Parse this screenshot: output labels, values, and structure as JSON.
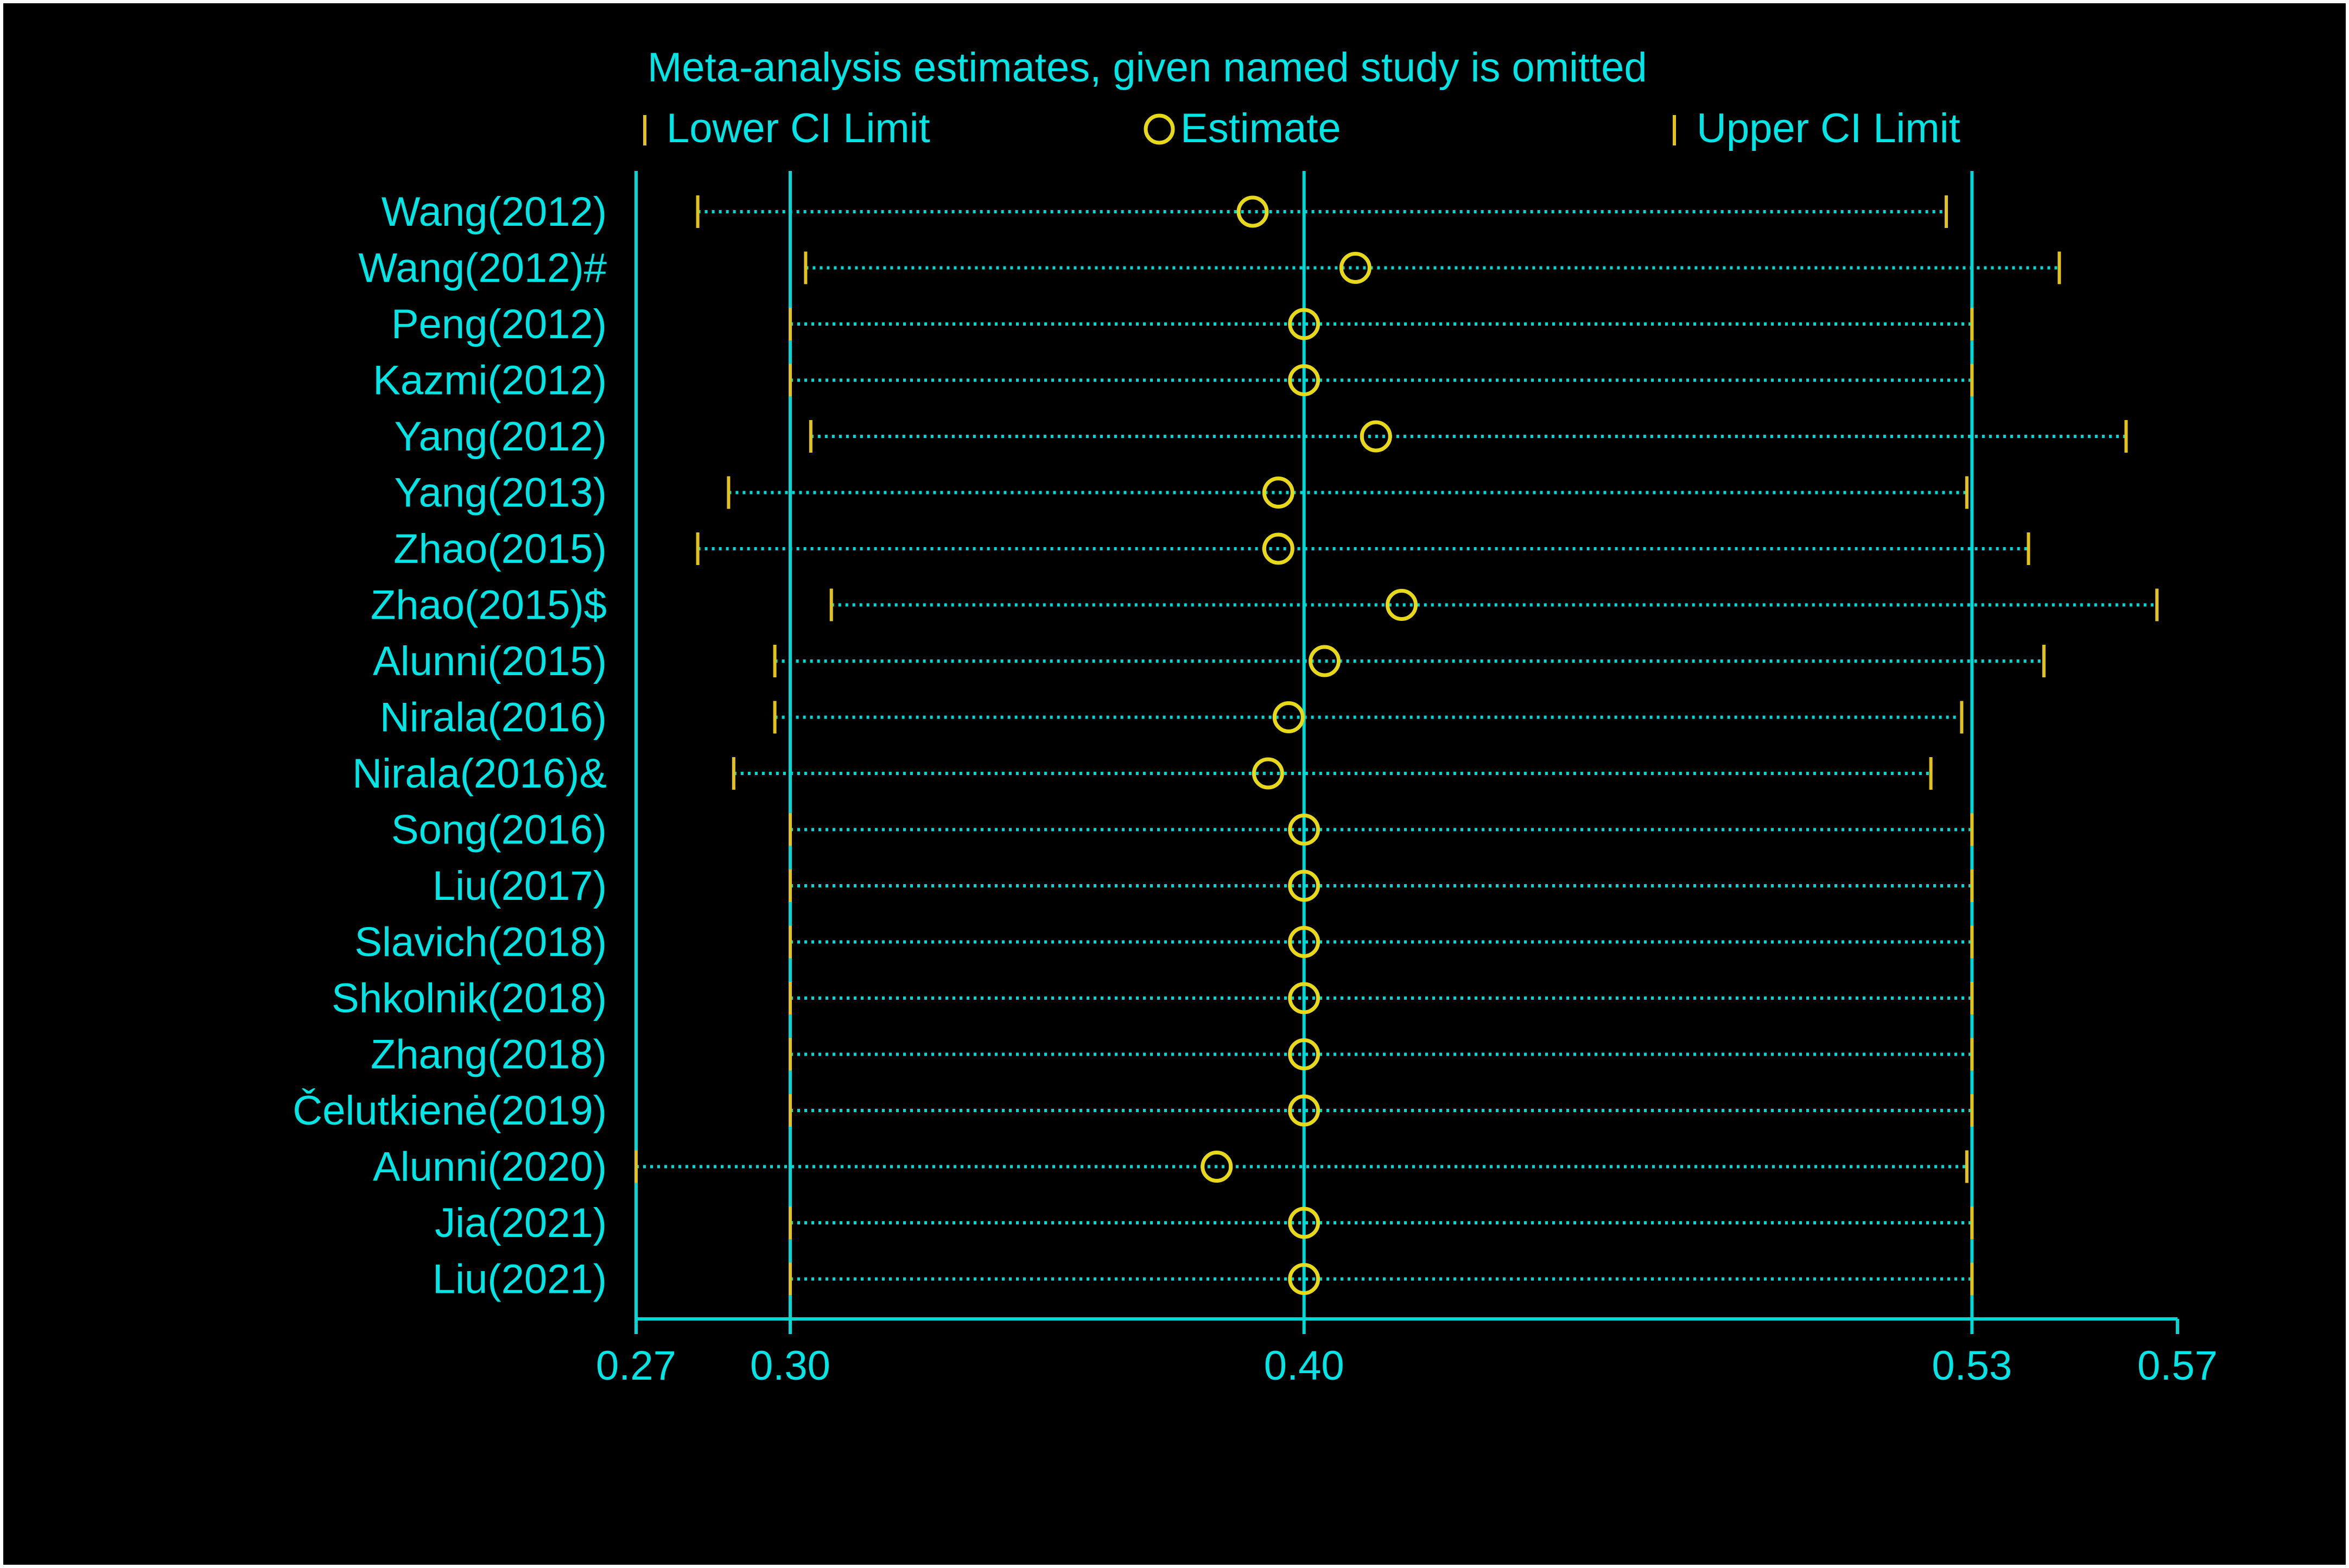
{
  "colors": {
    "background": "#000000",
    "frame": "#ffffff",
    "text": "#00e5e5",
    "axis": "#00d8d8",
    "ci_marker": "#e3c21a",
    "estimate": "#e8d81a",
    "dotted_line": "#00d8d8"
  },
  "chart_data": {
    "type": "scatter",
    "title": "Meta-analysis estimates, given named study is omitted",
    "legend": [
      {
        "symbol": "tick",
        "label": "Lower CI Limit"
      },
      {
        "symbol": "circle",
        "label": "Estimate"
      },
      {
        "symbol": "tick",
        "label": "Upper CI Limit"
      }
    ],
    "legend_position": "top",
    "x_ticks": [
      {
        "value": 0.27,
        "label": "0.27"
      },
      {
        "value": 0.3,
        "label": "0.30"
      },
      {
        "value": 0.4,
        "label": "0.40"
      },
      {
        "value": 0.53,
        "label": "0.53"
      },
      {
        "value": 0.57,
        "label": "0.57"
      }
    ],
    "x_range": [
      0.27,
      0.57
    ],
    "reference_lines": [
      0.27,
      0.3,
      0.4,
      0.53
    ],
    "studies": [
      {
        "name": "Wang(2012)",
        "lower": 0.282,
        "estimate": 0.39,
        "upper": 0.525
      },
      {
        "name": "Wang(2012)#",
        "lower": 0.303,
        "estimate": 0.41,
        "upper": 0.547
      },
      {
        "name": "Peng(2012)",
        "lower": 0.3,
        "estimate": 0.4,
        "upper": 0.53
      },
      {
        "name": "Kazmi(2012)",
        "lower": 0.3,
        "estimate": 0.4,
        "upper": 0.53
      },
      {
        "name": "Yang(2012)",
        "lower": 0.304,
        "estimate": 0.414,
        "upper": 0.56
      },
      {
        "name": "Yang(2013)",
        "lower": 0.288,
        "estimate": 0.395,
        "upper": 0.529
      },
      {
        "name": "Zhao(2015)",
        "lower": 0.282,
        "estimate": 0.395,
        "upper": 0.541
      },
      {
        "name": "Zhao(2015)$",
        "lower": 0.308,
        "estimate": 0.419,
        "upper": 0.566
      },
      {
        "name": "Alunni(2015)",
        "lower": 0.297,
        "estimate": 0.404,
        "upper": 0.544
      },
      {
        "name": "Nirala(2016)",
        "lower": 0.297,
        "estimate": 0.397,
        "upper": 0.528
      },
      {
        "name": "Nirala(2016)&",
        "lower": 0.289,
        "estimate": 0.393,
        "upper": 0.522
      },
      {
        "name": "Song(2016)",
        "lower": 0.3,
        "estimate": 0.4,
        "upper": 0.53
      },
      {
        "name": "Liu(2017)",
        "lower": 0.3,
        "estimate": 0.4,
        "upper": 0.53
      },
      {
        "name": "Slavich(2018)",
        "lower": 0.3,
        "estimate": 0.4,
        "upper": 0.53
      },
      {
        "name": "Shkolnik(2018)",
        "lower": 0.3,
        "estimate": 0.4,
        "upper": 0.53
      },
      {
        "name": "Zhang(2018)",
        "lower": 0.3,
        "estimate": 0.4,
        "upper": 0.53
      },
      {
        "name": "Čelutkienė(2019)",
        "lower": 0.3,
        "estimate": 0.4,
        "upper": 0.53
      },
      {
        "name": "Alunni(2020)",
        "lower": 0.27,
        "estimate": 0.383,
        "upper": 0.529
      },
      {
        "name": "Jia(2021)",
        "lower": 0.3,
        "estimate": 0.4,
        "upper": 0.53
      },
      {
        "name": "Liu(2021)",
        "lower": 0.3,
        "estimate": 0.4,
        "upper": 0.53
      }
    ]
  }
}
